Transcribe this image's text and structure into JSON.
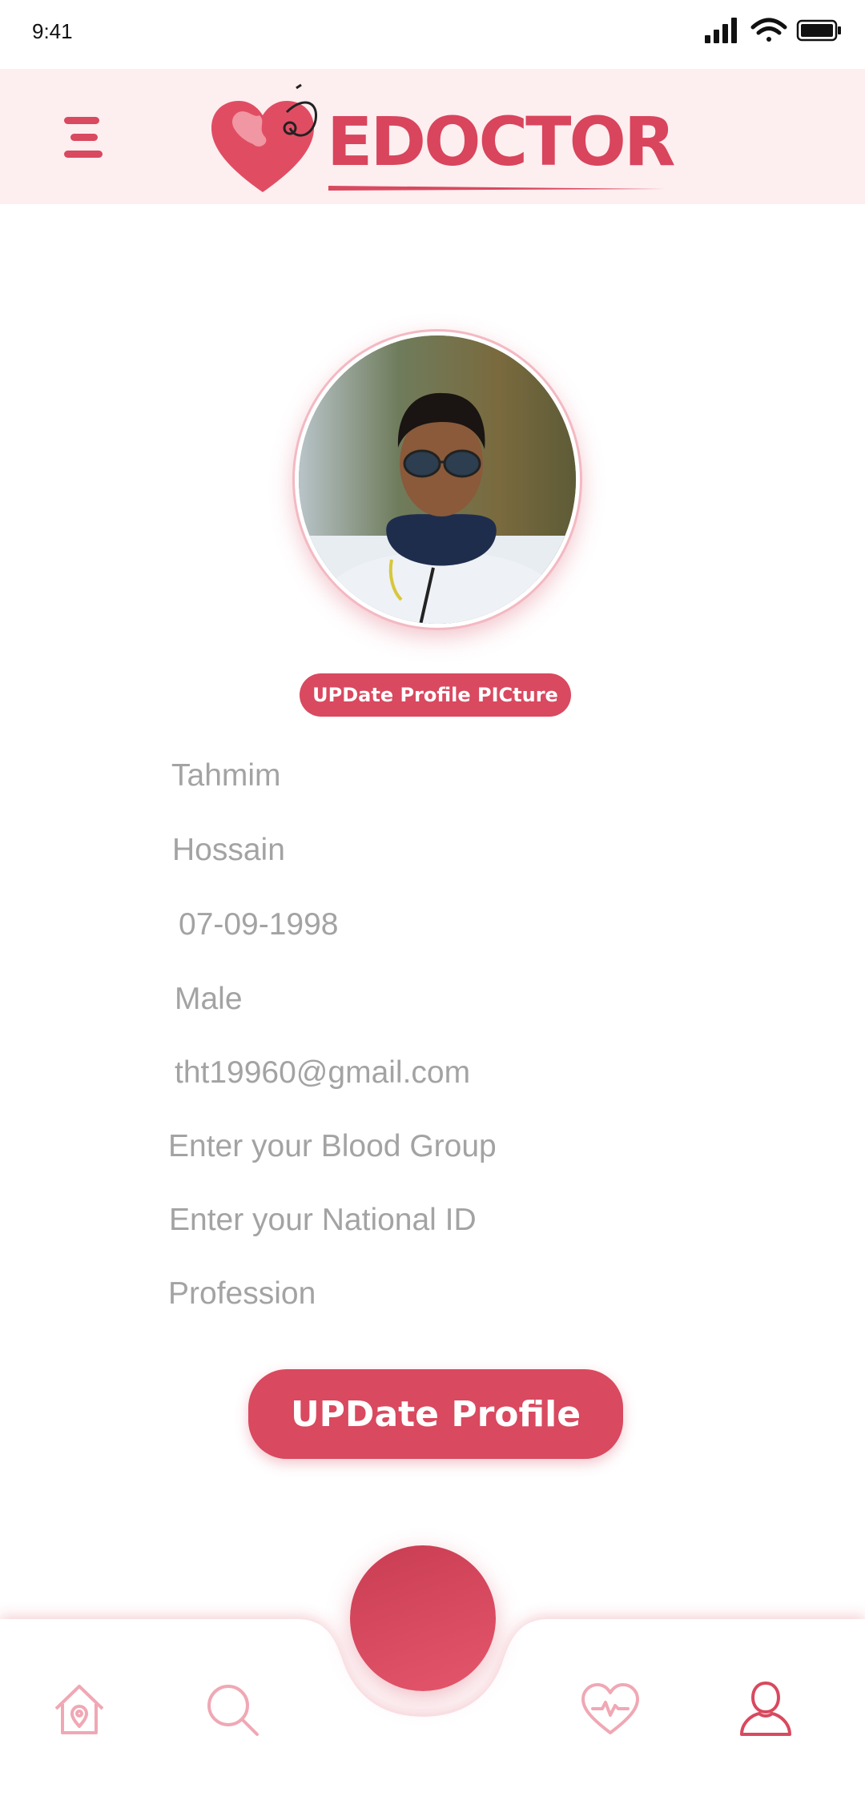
{
  "status_bar": {
    "time": "9:41"
  },
  "header": {
    "logo_text": "EDOCTOR"
  },
  "profile": {
    "update_picture_label": "UPDate Profile PICture",
    "fields": {
      "first_name": "Tahmim",
      "last_name": "Hossain",
      "dob": "07-09-1998",
      "gender": "Male",
      "email": "tht19960@gmail.com",
      "blood_group_placeholder": "Enter your Blood Group",
      "national_id_placeholder": "Enter your National ID",
      "profession_placeholder": "Profession"
    },
    "update_profile_label": "UPDate Profile"
  },
  "bottom_nav": {
    "items": [
      "home-icon",
      "search-icon",
      "heart-pulse-icon",
      "user-icon"
    ],
    "active": "user-icon"
  },
  "colors": {
    "accent": "#d9495f",
    "header_bg": "#fdeef0",
    "inactive_icon": "#f0a8b4"
  }
}
